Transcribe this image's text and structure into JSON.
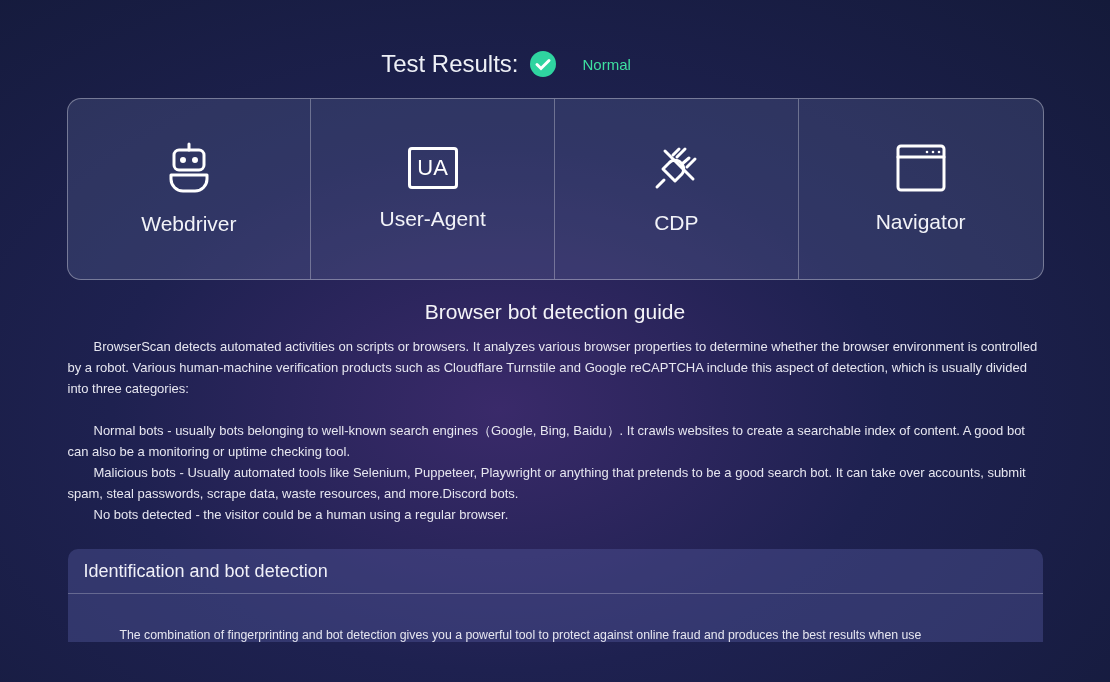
{
  "result": {
    "label": "Test Results:",
    "status": "Normal",
    "passed": true
  },
  "checks": [
    {
      "kind": "robot",
      "label": "Webdriver"
    },
    {
      "kind": "ua",
      "badge": "UA",
      "label": "User-Agent"
    },
    {
      "kind": "plug",
      "label": "CDP"
    },
    {
      "kind": "window",
      "label": "Navigator"
    }
  ],
  "guide": {
    "title": "Browser bot detection guide",
    "intro": "BrowserScan detects automated activities on scripts or browsers. It analyzes various browser properties to determine whether the browser environment is controlled by a robot. Various human-machine verification products such as Cloudflare Turnstile and Google reCAPTCHA include this aspect of detection, which is usually divided into three categories:",
    "items": [
      "Normal bots - usually bots belonging to well-known search engines（Google, Bing, Baidu）. It crawls websites to create a searchable index of content. A good bot can also be a monitoring or uptime checking tool.",
      "Malicious bots - Usually automated tools like Selenium, Puppeteer, Playwright or anything that pretends to be a good search bot. It can take over accounts, submit spam, steal passwords, scrape data, waste resources, and more.Discord bots.",
      "No bots detected - the visitor could be a human using a regular browser."
    ]
  },
  "section": {
    "title": "Identification and bot detection",
    "text": "The combination of fingerprinting and bot detection gives you a powerful tool to protect against online fraud and produces the best results when use"
  }
}
